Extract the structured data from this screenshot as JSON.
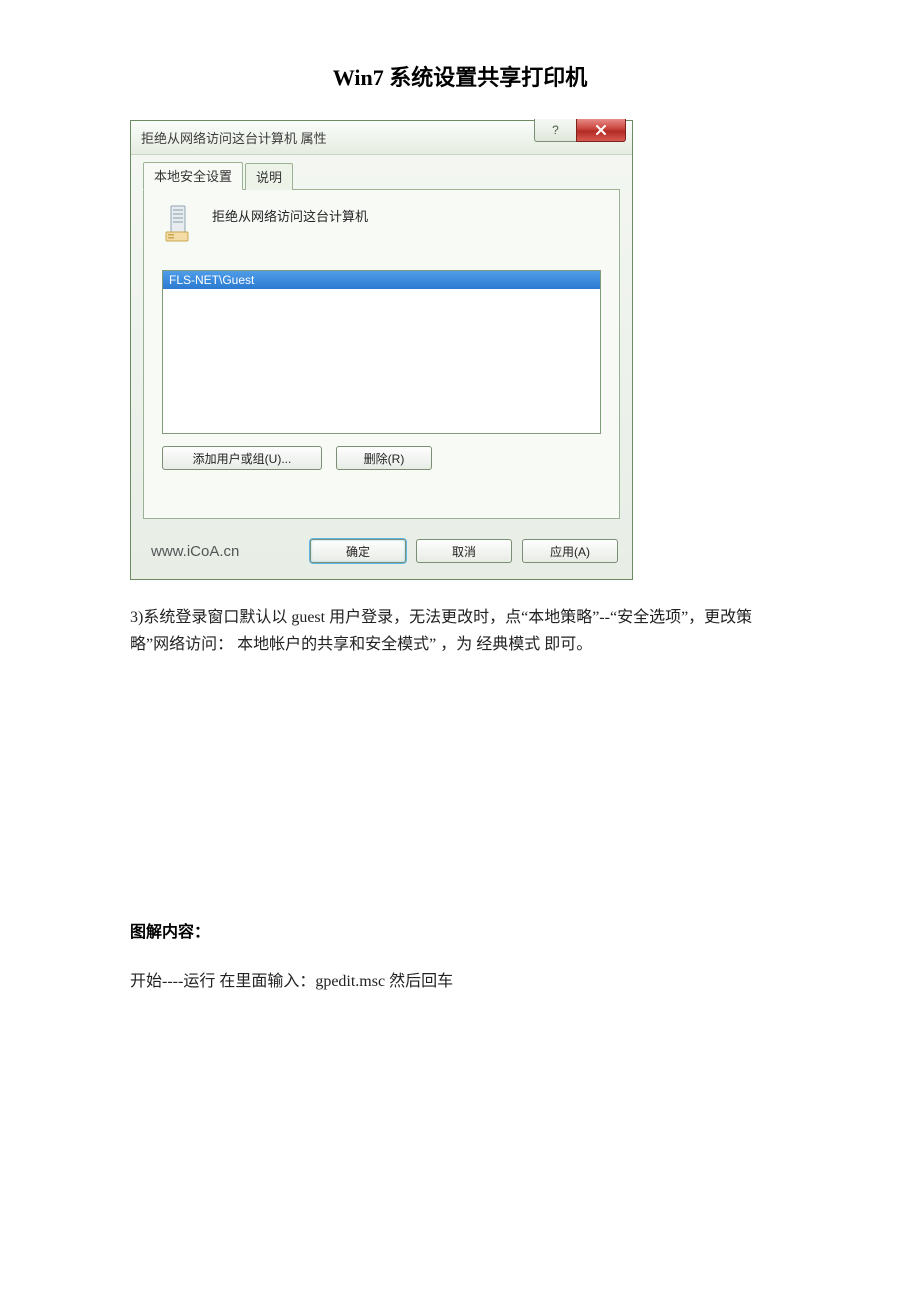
{
  "doc": {
    "title": "Win7 系统设置共享打印机",
    "paragraph3": "3)系统登录窗口默认以 guest 用户登录，无法更改时，点“本地策略”--“安全选项”，更改策略”网络访问：  本地帐户的共享和安全模式”   ，为   经典模式  即可。",
    "section_head": "图解内容：",
    "instruction_line": "开始----运行   在里面输入：gpedit.msc 然后回车"
  },
  "dialog": {
    "title": "拒绝从网络访问这台计算机 属性",
    "help_symbol": "?",
    "tabs": {
      "active": "本地安全设置",
      "inactive": "说明"
    },
    "policy_label": "拒绝从网络访问这台计算机",
    "list": {
      "selected_item": "FLS-NET\\Guest"
    },
    "buttons": {
      "add_user": "添加用户或组(U)...",
      "remove": "删除(R)",
      "ok": "确定",
      "cancel": "取消",
      "apply": "应用(A)"
    },
    "watermark": "www.iCoA.cn"
  }
}
